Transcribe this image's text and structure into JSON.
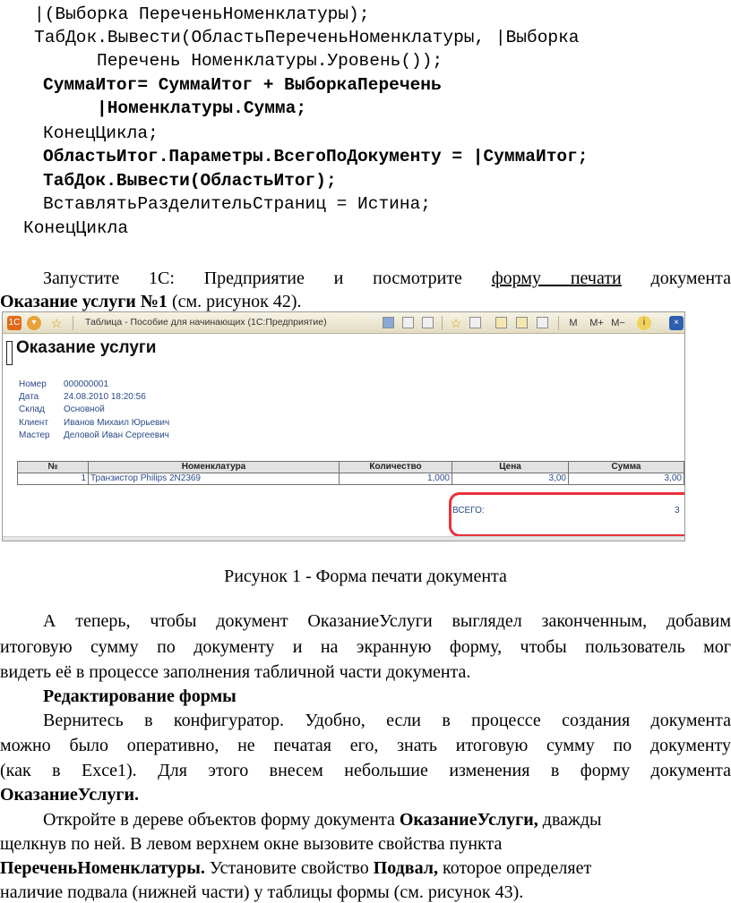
{
  "code_lines": [
    "|(Выборка ПереченьНоменклатуры);",
    "ТабДок.Вывести(ОбластьПереченьНоменклатуры, |Выборка",
    "Перечень Номенклатуры.Уровень());",
    "СуммаИтог= СуммаИтог + ВыборкаПеречень",
    "|Номенклатуры.Сумма;",
    "КонецЦикла;",
    "ОбластьИтог.Параметры.ВсегоПоДокументу = |СуммаИтог;",
    "ТабДок.Вывести(ОбластьИтог);",
    "ВставлятьРазделительСтраниц = Истина;",
    "КонецЦикла"
  ],
  "intro": {
    "t1": "Запустите 1С: Предприятие и посмотрите",
    "link": "форму печати",
    "t2": "документа",
    "bold": "Оказание услуги №1",
    "t3": " (см. рисунок 42)."
  },
  "screenshot": {
    "window_title": "Таблица - Пособие для начинающих  (1С:Предприятие)",
    "toolbar_m": [
      "M",
      "M+",
      "M−"
    ],
    "doc_title": "Оказание услуги",
    "fields": [
      {
        "label": "Номер",
        "value": "000000001"
      },
      {
        "label": "Дата",
        "value": "24.08.2010 18:20:56"
      },
      {
        "label": "Склад",
        "value": "Основной"
      },
      {
        "label": "Клиент",
        "value": "Иванов Михаил Юрьевич"
      },
      {
        "label": "Мастер",
        "value": "Деловой Иван Сергеевич"
      }
    ],
    "columns": [
      "№",
      "Номенклатура",
      "Количество",
      "Цена",
      "Сумма"
    ],
    "row": {
      "num": "1",
      "name": "Транзистор Philips 2N2369",
      "qty": "1,000",
      "price": "3,00",
      "sum": "3,00"
    },
    "total_label": "ВСЕГО:",
    "total_value": "3"
  },
  "caption": "Рисунок 1 - Форма печати документа",
  "p1": [
    "А теперь, чтобы документ ОказаниеУслуги выглядел законченным, добавим",
    "итоговую сумму по документу и на экранную форму, чтобы пользователь мог",
    "видеть её в процессе заполнения табличной части документа."
  ],
  "heading": "Редактирование формы",
  "p2": [
    "Вернитесь в конфигуратор. Удобно, если в процессе создания документа",
    "можно было оперативно, не печатая его, знать итоговую сумму по документу",
    "(как в Exce1). Для этого внесем небольшие изменения в форму документа"
  ],
  "p2_bold": "ОказаниеУслуги.",
  "p3": {
    "a1": "Откройте в дереве объектов форму документа ",
    "a1b": "ОказаниеУслуги,",
    "a2": " дважды",
    "b": "щелкнув по ней. В левом верхнем окне вызовите свойства пункта",
    "c1b": "ПереченьНоменклатуры.",
    "c2": " Установите свойство ",
    "c3b": "Подвал,",
    "c4": " которое определяет",
    "d": "наличие подвала (нижней части) у таблицы формы (см. рисунок 43)."
  },
  "colors": {
    "highlight": "#e8323b",
    "field_text": "#2a4a8a"
  }
}
